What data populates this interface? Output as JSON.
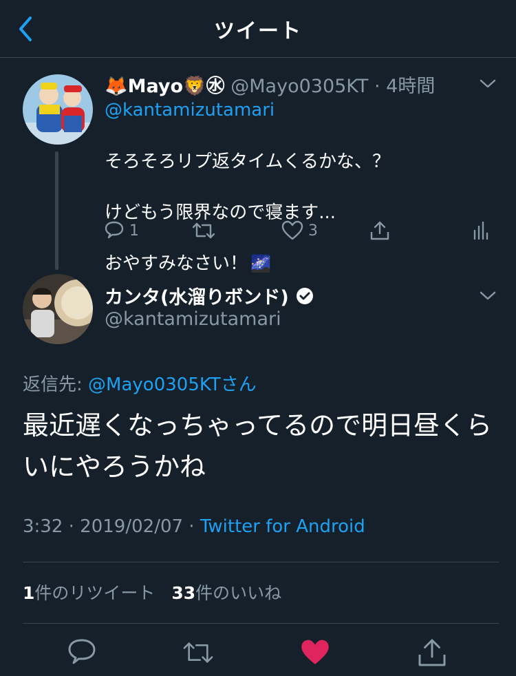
{
  "header": {
    "title": "ツイート"
  },
  "tweet1": {
    "name": "🦊Mayo🦁㊌",
    "handle": "@Mayo0305KT",
    "time": "· 4時間",
    "mention": "@kantamizutamari",
    "lines": [
      "そろそろリプ返タイムくるかな、？",
      "けどもう限界なので寝ます...",
      "おやすみなさい！"
    ],
    "emoji": "🌌",
    "reply_count": "1",
    "retweet_count": "",
    "like_count": "3"
  },
  "tweet2": {
    "name": "カンタ(水溜りボンド)",
    "handle": "@kantamizutamari",
    "reply_to_label": "返信先: ",
    "reply_to_user": "@Mayo0305KTさん",
    "text": "最近遅くなっちゃってるので明日昼くらいにやろうかね",
    "time": "3:32 · 2019/02/07 · ",
    "source": "Twitter for Android",
    "retweets_num": "1",
    "retweets_label": "件のリツイート",
    "likes_num": "33",
    "likes_label": "件のいいね"
  },
  "colors": {
    "background": "#15202b",
    "accent": "#1da1f2",
    "muted": "#8899a6",
    "like": "#e0245e",
    "divider": "#38444d"
  },
  "icons": [
    "back-arrow-icon",
    "chevron-down-icon",
    "reply-icon",
    "retweet-icon",
    "like-icon",
    "share-icon",
    "analytics-icon",
    "verified-badge-icon"
  ]
}
